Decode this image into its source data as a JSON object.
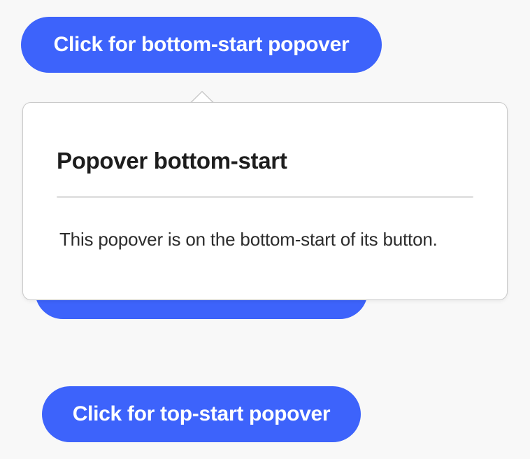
{
  "buttons": {
    "bottom_start": "Click for bottom-start popover",
    "hidden_behind": "",
    "top_start": "Click for top-start popover"
  },
  "popover": {
    "placement": "bottom-start",
    "title": "Popover bottom-start",
    "body": "This popover is on the bottom-start of its button."
  },
  "colors": {
    "button_bg": "#3d63fb",
    "button_text": "#ffffff",
    "page_bg": "#f8f8f8",
    "popover_bg": "#ffffff",
    "popover_border": "#cacaca"
  }
}
